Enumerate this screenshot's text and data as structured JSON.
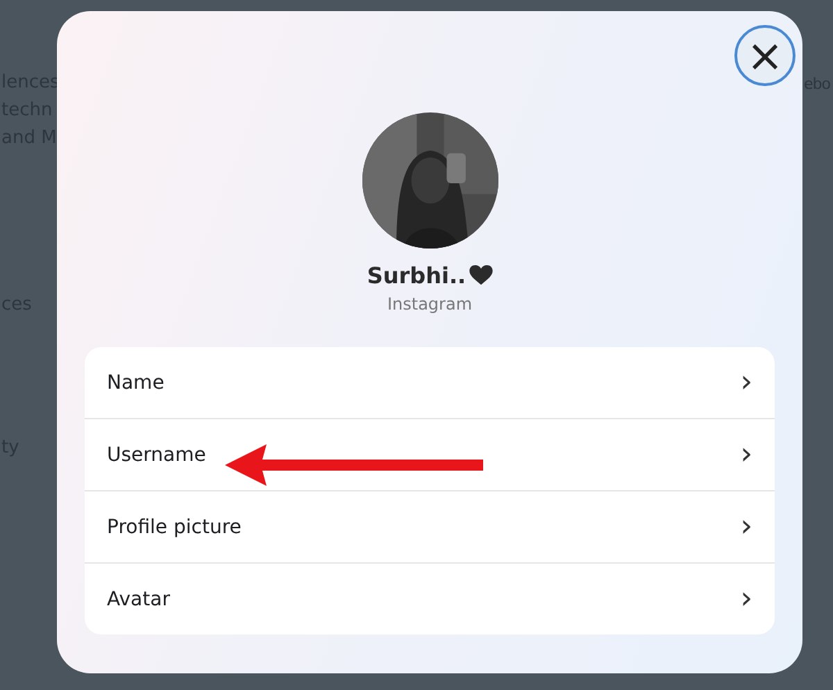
{
  "background": {
    "left_texts": [
      "lences",
      "techn",
      "and M",
      "ces",
      "ty"
    ],
    "right_texts": [
      "ebo"
    ]
  },
  "dialog": {
    "close_label": "×",
    "profile": {
      "kind": "picture",
      "name": "Surbhi..",
      "platform": "Instagram"
    },
    "items": [
      {
        "label": "Name",
        "chevron": "›"
      },
      {
        "label": "Username",
        "chevron": "›"
      },
      {
        "label": "Profile picture",
        "chevron": "›"
      },
      {
        "label": "Avatar",
        "chevron": "›"
      }
    ]
  },
  "annotation": {
    "kind": "arrow"
  }
}
